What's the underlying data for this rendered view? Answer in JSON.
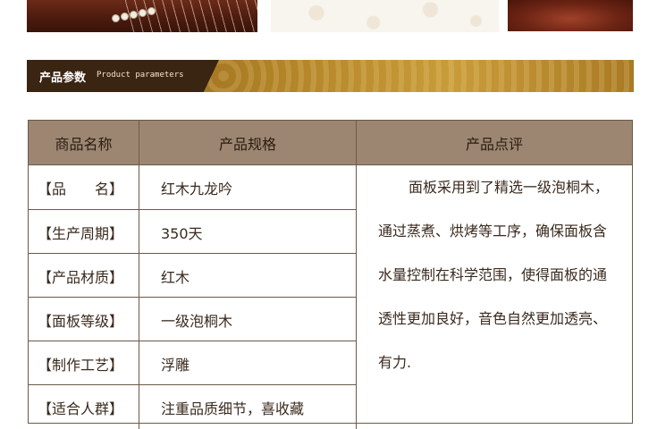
{
  "section": {
    "title": "产品参数",
    "subtitle": "Product parameters"
  },
  "table": {
    "headers": [
      "商品名称",
      "产品规格",
      "产品点评"
    ],
    "rows": [
      {
        "label": "【品　　名】",
        "value": "红木九龙吟"
      },
      {
        "label": "【生产周期】",
        "value": "350天"
      },
      {
        "label": "【产品材质】",
        "value": "红木"
      },
      {
        "label": "【面板等级】",
        "value": "一级泡桐木"
      },
      {
        "label": "【制作工艺】",
        "value": "浮雕"
      },
      {
        "label": "【适合人群】",
        "value": "注重品质细节，喜收藏"
      }
    ],
    "review_lines": [
      "面板采用到了精选一级泡桐木，",
      "通过蒸煮、烘烤等工序，确保面板含",
      "水量控制在科学范围，使得面板的通",
      "透性更加良好，音色自然更加透亮、",
      "有力."
    ]
  },
  "colors": {
    "header_bg": "#9c8672",
    "banner_gold": "#c99c3a",
    "banner_dark": "#3a2412",
    "border": "#6b5a48"
  }
}
